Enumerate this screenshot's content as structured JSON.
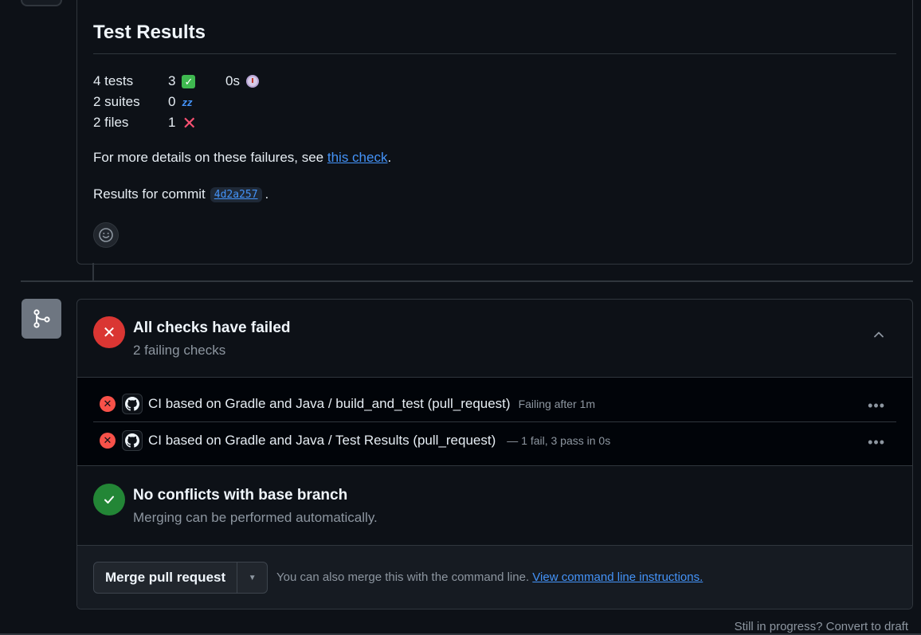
{
  "test_results": {
    "title": "Test Results",
    "stats": [
      {
        "label": "4 tests",
        "count": "3",
        "icon": "check-emoji-icon",
        "extra": "0s",
        "extra_icon": "alarm-clock-icon"
      },
      {
        "label": "2 suites",
        "count": "0",
        "icon": "zzz-emoji-icon"
      },
      {
        "label": "2 files",
        "count": "1",
        "icon": "cross-mark-emoji-icon"
      }
    ],
    "details_prefix": "For more details on these failures, see ",
    "details_link": "this check",
    "details_suffix": ".",
    "commit_prefix": "Results for commit",
    "commit_sha": "4d2a257",
    "commit_suffix": "."
  },
  "checks": {
    "title": "All checks have failed",
    "subtitle": "2 failing checks",
    "items": [
      {
        "name": "CI based on Gradle and Java / build_and_test (pull_request)",
        "meta": "Failing after 1m"
      },
      {
        "name": "CI based on Gradle and Java / Test Results (pull_request)",
        "meta": "— 1 fail, 3 pass in 0s"
      }
    ]
  },
  "conflicts": {
    "title": "No conflicts with base branch",
    "subtitle": "Merging can be performed automatically."
  },
  "merge": {
    "button_label": "Merge pull request",
    "hint": "You can also merge this with the command line.",
    "hint_link": "View command line instructions."
  },
  "draft": {
    "text": "Still in progress? Convert to draft"
  },
  "colors": {
    "background": "#0d1117",
    "fail": "#da3633",
    "success": "#238636",
    "link": "#4493f8",
    "muted": "#8d96a0"
  }
}
